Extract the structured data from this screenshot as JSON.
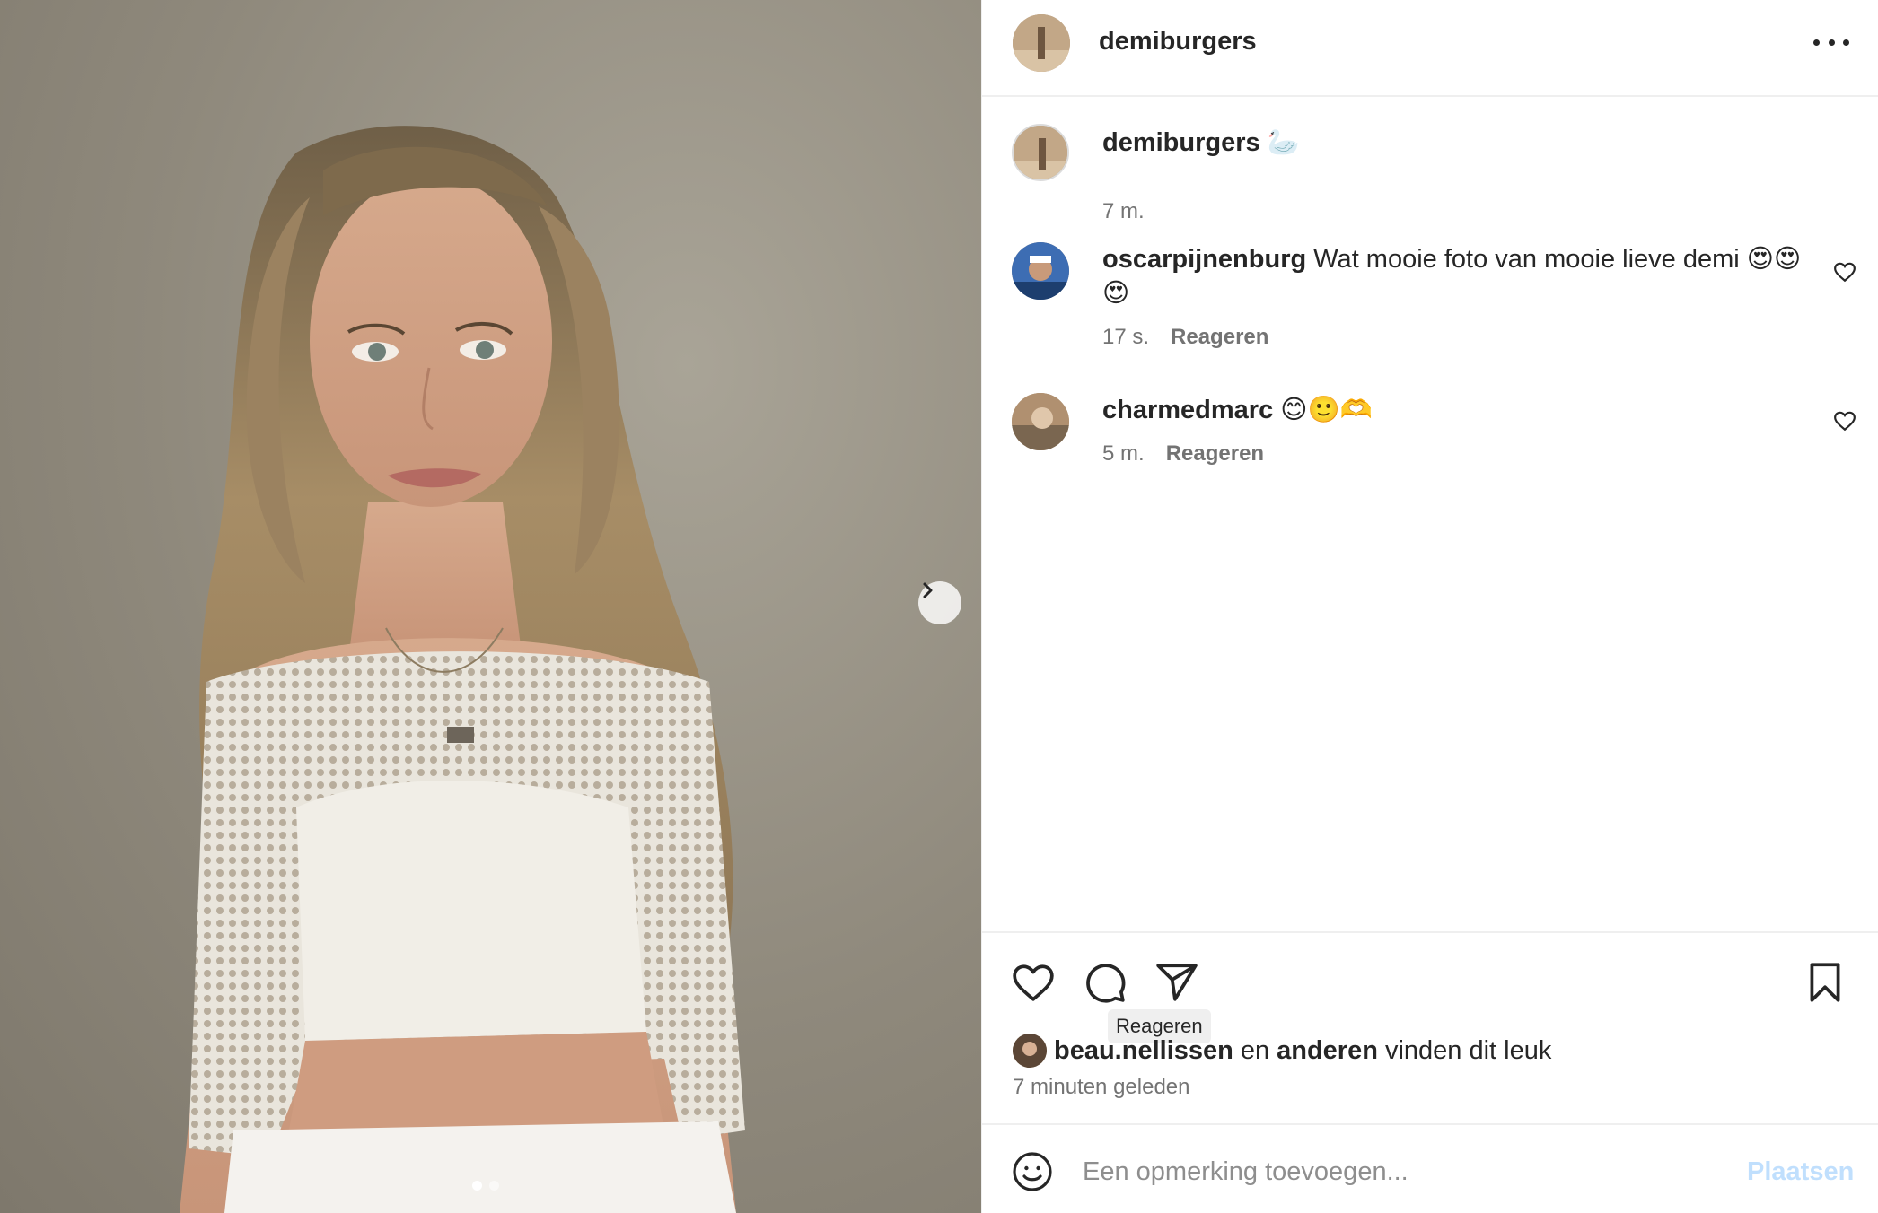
{
  "post": {
    "author": "demiburgers",
    "carousel": {
      "total_slides": 2,
      "active_slide": 1
    }
  },
  "caption": {
    "username": "demiburgers",
    "text": "🦢",
    "time": "7 m."
  },
  "comments": [
    {
      "username": "oscarpijnenburg",
      "text": "Wat mooie foto van mooie lieve demi 😍😍😍",
      "time": "17 s.",
      "reply_label": "Reageren"
    },
    {
      "username": "charmedmarc",
      "text": "😊🙂🫶",
      "time": "5 m.",
      "reply_label": "Reageren"
    }
  ],
  "actions": {
    "like_icon": "heart-icon",
    "comment_icon": "comment-icon",
    "share_icon": "paper-plane-icon",
    "save_icon": "bookmark-icon",
    "tooltip": "Reageren"
  },
  "likes": {
    "user": "beau.nellissen",
    "connector": "en",
    "others": "anderen",
    "suffix": "vinden dit leuk"
  },
  "post_time": "7 minuten geleden",
  "comment_box": {
    "placeholder": "Een opmerking toevoegen...",
    "post_label": "Plaatsen",
    "post_label_color": "#c0dffd"
  },
  "colors": {
    "text": "#262626",
    "secondary": "#737373",
    "divider": "#efefef"
  }
}
